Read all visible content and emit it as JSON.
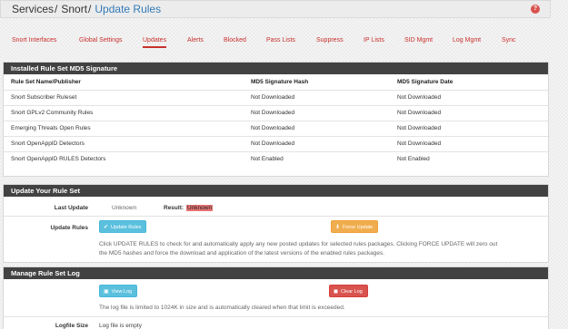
{
  "breadcrumb": {
    "crumb1": "Services",
    "crumb2": "Snort",
    "current": "Update Rules",
    "separator": "/"
  },
  "help_icon": "?",
  "tabs": [
    {
      "label": "Snort Interfaces"
    },
    {
      "label": "Global Settings"
    },
    {
      "label": "Updates"
    },
    {
      "label": "Alerts"
    },
    {
      "label": "Blocked"
    },
    {
      "label": "Pass Lists"
    },
    {
      "label": "Suppress"
    },
    {
      "label": "IP Lists"
    },
    {
      "label": "SID Mgmt"
    },
    {
      "label": "Log Mgmt"
    },
    {
      "label": "Sync"
    }
  ],
  "installed": {
    "heading": "Installed Rule Set MD5 Signature",
    "columns": [
      "Rule Set Name/Publisher",
      "MD5 Signature Hash",
      "MD5 Signature Date"
    ],
    "rows": [
      [
        "Snort Subscriber Ruleset",
        "Not Downloaded",
        "Not Downloaded"
      ],
      [
        "Snort GPLv2 Community Rules",
        "Not Downloaded",
        "Not Downloaded"
      ],
      [
        "Emerging Threats Open Rules",
        "Not Downloaded",
        "Not Downloaded"
      ],
      [
        "Snort OpenAppID Detectors",
        "Not Downloaded",
        "Not Downloaded"
      ],
      [
        "Snort OpenAppID RULES Detectors",
        "Not Enabled",
        "Not Enabled"
      ]
    ]
  },
  "update": {
    "heading": "Update Your Rule Set",
    "last_update_label": "Last Update",
    "last_update_value": "Unknown",
    "result_label": "Result:",
    "result_value": "Unknown",
    "update_rules_label": "Update Rules",
    "update_button": "Update Rules",
    "force_button": "Force Update",
    "help_line1": "Click UPDATE RULES to check for and automatically apply any new posted updates for selected rules packages. Clicking FORCE UPDATE will zero out",
    "help_line2": "the MD5 hashes and force the download and application of the latest versions of the enabled rules packages."
  },
  "log": {
    "heading": "Manage Rule Set Log",
    "view_button": "View Log",
    "clear_button": "Clear Log",
    "help": "The log file is limited to 1024K in size and is automatically cleared when that limit is exceeded.",
    "size_label": "Logfile Size",
    "size_value": "Log file is empty"
  },
  "icons": {
    "help": "question-circle-icon",
    "update": "check-icon",
    "force": "download-icon",
    "view": "file-icon",
    "clear": "trash-icon"
  },
  "colors": {
    "accent": "#c9302c",
    "link": "#337ab7",
    "heading": "#424242",
    "info": "#5bc0de",
    "warning": "#f0ad4e",
    "danger": "#d9534f"
  }
}
